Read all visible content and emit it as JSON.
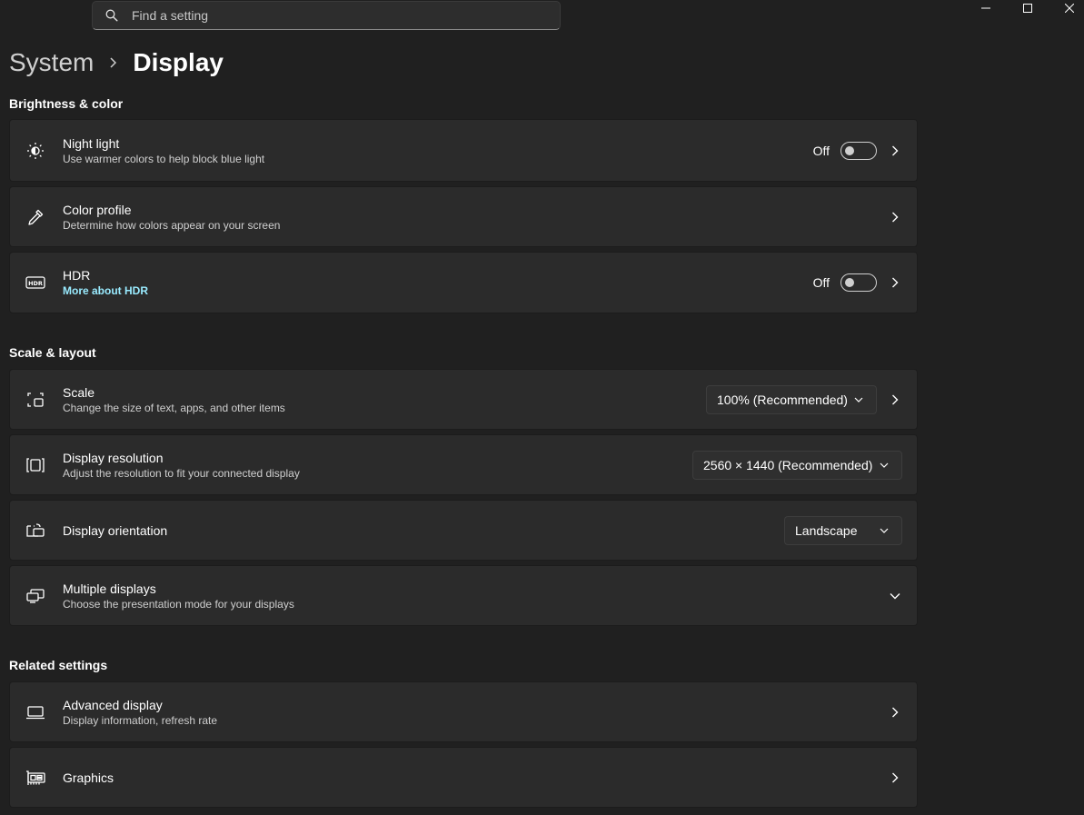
{
  "search": {
    "placeholder": "Find a setting"
  },
  "window_controls": {
    "icons": [
      "minimize-icon",
      "maximize-icon",
      "close-icon"
    ]
  },
  "breadcrumb": {
    "parent": "System",
    "current": "Display"
  },
  "sections": {
    "brightness": {
      "title": "Brightness & color",
      "night_light": {
        "title": "Night light",
        "subtitle": "Use warmer colors to help block blue light",
        "state": "Off"
      },
      "color_profile": {
        "title": "Color profile",
        "subtitle": "Determine how colors appear on your screen"
      },
      "hdr": {
        "title": "HDR",
        "link": "More about HDR",
        "state": "Off"
      }
    },
    "scale_layout": {
      "title": "Scale & layout",
      "scale": {
        "title": "Scale",
        "subtitle": "Change the size of text, apps, and other items",
        "value": "100% (Recommended)"
      },
      "resolution": {
        "title": "Display resolution",
        "subtitle": "Adjust the resolution to fit your connected display",
        "value": "2560 × 1440 (Recommended)"
      },
      "orientation": {
        "title": "Display orientation",
        "value": "Landscape"
      },
      "multiple": {
        "title": "Multiple displays",
        "subtitle": "Choose the presentation mode for your displays"
      }
    },
    "related": {
      "title": "Related settings",
      "advanced": {
        "title": "Advanced display",
        "subtitle": "Display information, refresh rate"
      },
      "graphics": {
        "title": "Graphics"
      }
    }
  },
  "colors": {
    "background": "#202020",
    "card": "#2b2b2b",
    "link": "#99ebff"
  }
}
